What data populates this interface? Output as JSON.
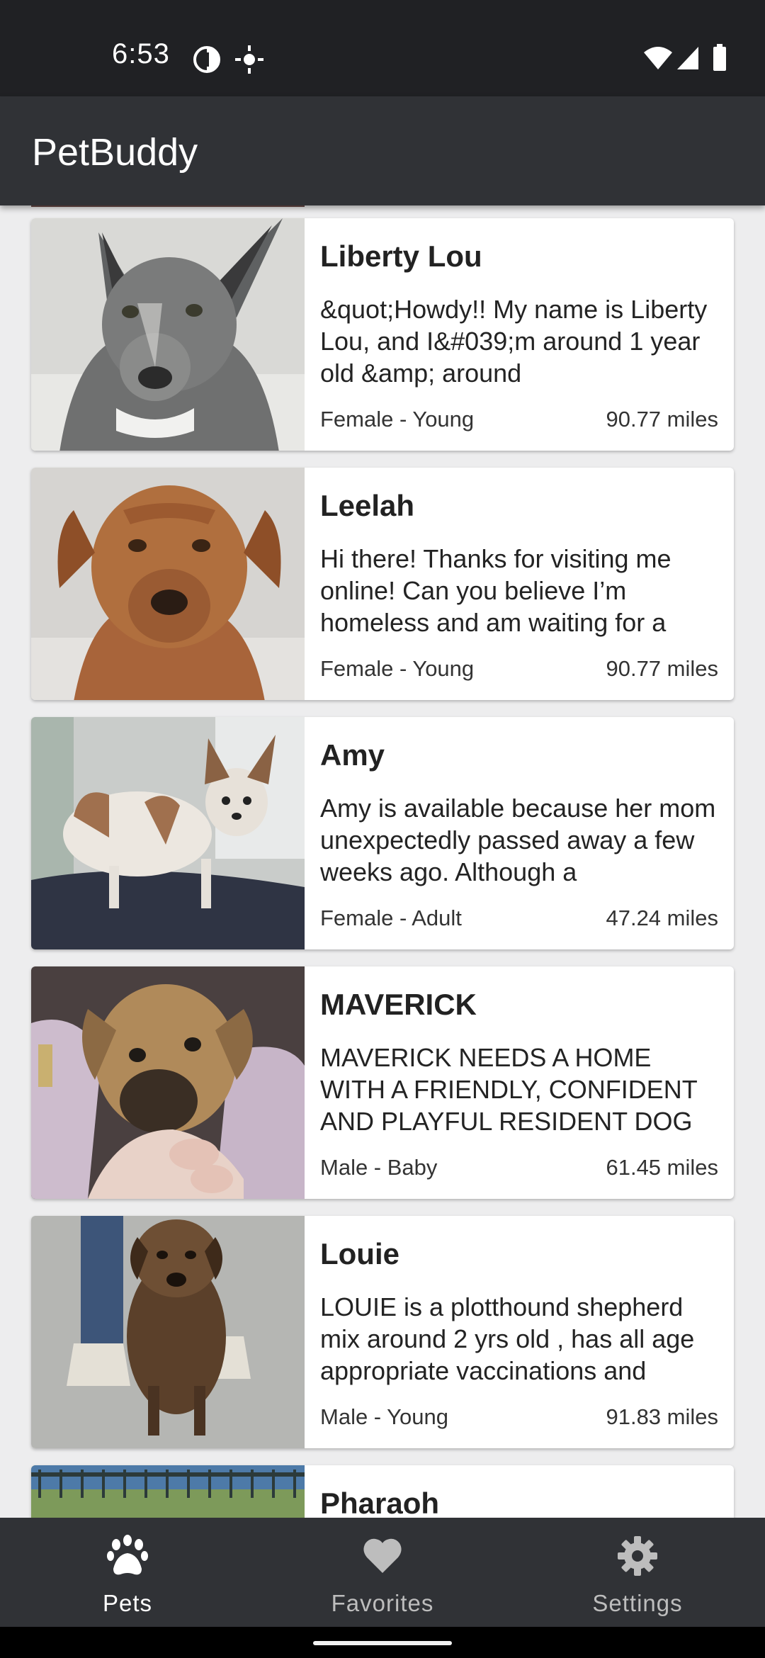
{
  "status_bar": {
    "time": "6:53",
    "icons": [
      "data-saver-icon",
      "location-icon",
      "wifi-icon",
      "signal-icon",
      "battery-icon"
    ]
  },
  "app_bar": {
    "title": "PetBuddy"
  },
  "pets": [
    {
      "name": "Liberty Lou",
      "description": "&quot;Howdy!! My name is Liberty Lou, and I&#039;m around 1 year old &amp; around",
      "meta": "Female - Young",
      "distance": "90.77 miles"
    },
    {
      "name": "Leelah",
      "description": "Hi there! Thanks for visiting me online! Can you believe I’m homeless and am waiting for a",
      "meta": "Female - Young",
      "distance": "90.77 miles"
    },
    {
      "name": "Amy",
      "description": "Amy is available because her mom unexpectedly passed away a few weeks ago.  Although a",
      "meta": "Female - Adult",
      "distance": "47.24 miles"
    },
    {
      "name": "MAVERICK",
      "description": "MAVERICK NEEDS A HOME WITH A FRIENDLY, CONFIDENT AND PLAYFUL RESIDENT DOG",
      "meta": "Male - Baby",
      "distance": "61.45 miles"
    },
    {
      "name": "Louie",
      "description": "LOUIE is a plotthound shepherd mix around 2 yrs old , has all age appropriate vaccinations and",
      "meta": "Male - Young",
      "distance": "91.83 miles"
    },
    {
      "name": "Pharaoh"
    }
  ],
  "bottom_nav": {
    "items": [
      {
        "label": "Pets",
        "icon": "paw-icon",
        "active": true
      },
      {
        "label": "Favorites",
        "icon": "heart-icon",
        "active": false
      },
      {
        "label": "Settings",
        "icon": "gear-icon",
        "active": false
      }
    ]
  },
  "colors": {
    "status_bar": "#202124",
    "app_bar": "#303236",
    "list_background": "#ededee",
    "card": "#ffffff",
    "nav_active": "#ffffff",
    "nav_inactive": "#bdbdbd"
  }
}
